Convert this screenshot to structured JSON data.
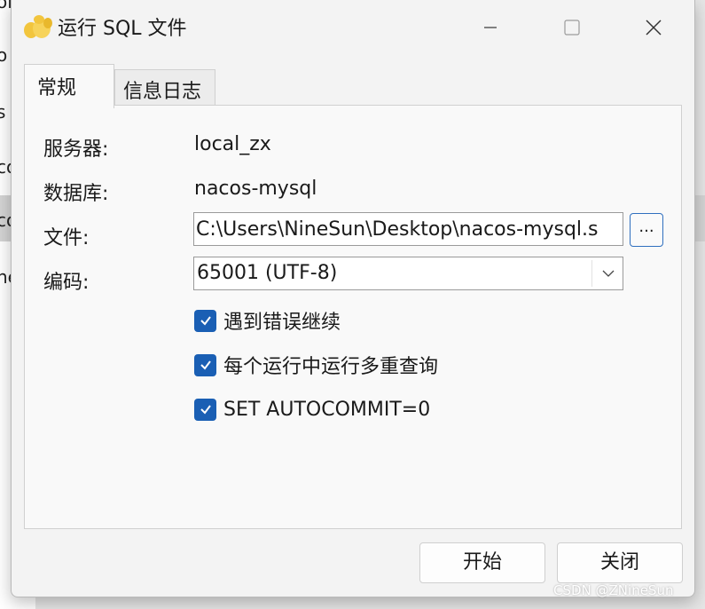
{
  "background_window": {
    "row_fragments": [
      "oll",
      "o",
      "s",
      "co",
      "co",
      "ne"
    ]
  },
  "window": {
    "title": "运行 SQL 文件",
    "app_icon": "navicat-icon",
    "controls": {
      "minimize": "minimize-icon",
      "maximize": "maximize-icon",
      "close": "close-icon"
    }
  },
  "tabs": [
    {
      "label": "常规",
      "active": true
    },
    {
      "label": "信息日志",
      "active": false
    }
  ],
  "form": {
    "server_label": "服务器:",
    "server_value": "local_zx",
    "database_label": "数据库:",
    "database_value": "nacos-mysql",
    "file_label": "文件:",
    "file_value": "C:\\Users\\NineSun\\Desktop\\nacos-mysql.s",
    "browse_label": "...",
    "encoding_label": "编码:",
    "encoding_value": "65001 (UTF-8)"
  },
  "options": [
    {
      "label": "遇到错误继续",
      "checked": true
    },
    {
      "label": "每个运行中运行多重查询",
      "checked": true
    },
    {
      "label": "SET AUTOCOMMIT=0",
      "checked": true
    }
  ],
  "buttons": {
    "start": "开始",
    "close": "关闭"
  },
  "watermark": "CSDN @ZNineSun",
  "colors": {
    "checkbox": "#1a5fb4",
    "browse_border": "#2f6fbf",
    "icon_yellow": "#f2c53d"
  }
}
